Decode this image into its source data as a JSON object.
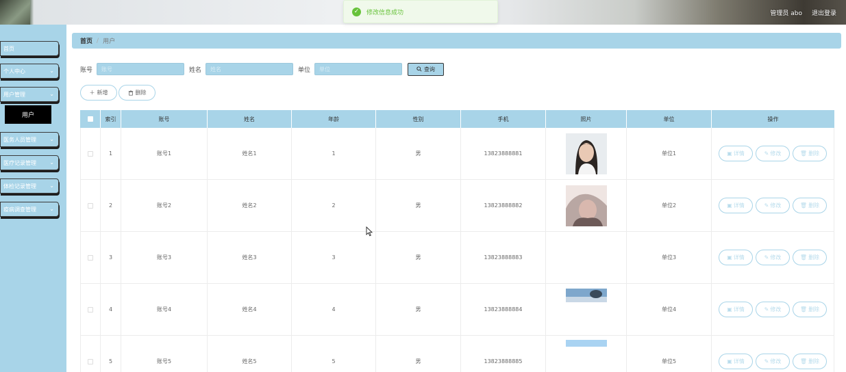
{
  "header": {
    "admin_label": "管理员 abo",
    "logout_label": "退出登录"
  },
  "toast": {
    "message": "修改信息成功",
    "icon": "check-circle-icon",
    "color": "#67c23a"
  },
  "sidebar": {
    "items": [
      {
        "label": "首页",
        "has_chevron": false
      },
      {
        "label": "个人中心",
        "has_chevron": true
      },
      {
        "label": "用户管理",
        "has_chevron": true
      },
      {
        "label": "用户",
        "is_sub": true,
        "active": true
      },
      {
        "label": "医务人员管理",
        "has_chevron": true
      },
      {
        "label": "医疗记录管理",
        "has_chevron": true
      },
      {
        "label": "体检记录管理",
        "has_chevron": true
      },
      {
        "label": "疫病调查管理",
        "has_chevron": true
      }
    ]
  },
  "breadcrumb": {
    "home": "首页",
    "separator": "/",
    "current": "用户"
  },
  "search": {
    "fields": [
      {
        "label": "账号",
        "placeholder": "账号"
      },
      {
        "label": "姓名",
        "placeholder": "姓名"
      },
      {
        "label": "单位",
        "placeholder": "单位"
      }
    ],
    "button_label": "查询"
  },
  "actions": {
    "add_label": "新增",
    "delete_label": "删除"
  },
  "table": {
    "headers": [
      "索引",
      "账号",
      "姓名",
      "年龄",
      "性别",
      "手机",
      "照片",
      "单位",
      "操作"
    ],
    "rows": [
      {
        "index": "1",
        "account": "账号1",
        "name": "姓名1",
        "age": "1",
        "gender": "男",
        "phone": "13823888881",
        "photo": "portrait-1",
        "unit": "单位1"
      },
      {
        "index": "2",
        "account": "账号2",
        "name": "姓名2",
        "age": "2",
        "gender": "男",
        "phone": "13823888882",
        "photo": "portrait-2",
        "unit": "单位2"
      },
      {
        "index": "3",
        "account": "账号3",
        "name": "姓名3",
        "age": "3",
        "gender": "男",
        "phone": "13823888883",
        "photo": "",
        "unit": "单位3"
      },
      {
        "index": "4",
        "account": "账号4",
        "name": "姓名4",
        "age": "4",
        "gender": "男",
        "phone": "13823888884",
        "photo": "sky-strip",
        "unit": "单位4"
      },
      {
        "index": "5",
        "account": "账号5",
        "name": "姓名5",
        "age": "5",
        "gender": "男",
        "phone": "13823888885",
        "photo": "blue-strip",
        "unit": "单位5"
      }
    ],
    "row_actions": {
      "detail": "详情",
      "edit": "修改",
      "delete": "删除"
    }
  },
  "colors": {
    "accent": "#a8d4e8",
    "active_menu": "#000000"
  }
}
